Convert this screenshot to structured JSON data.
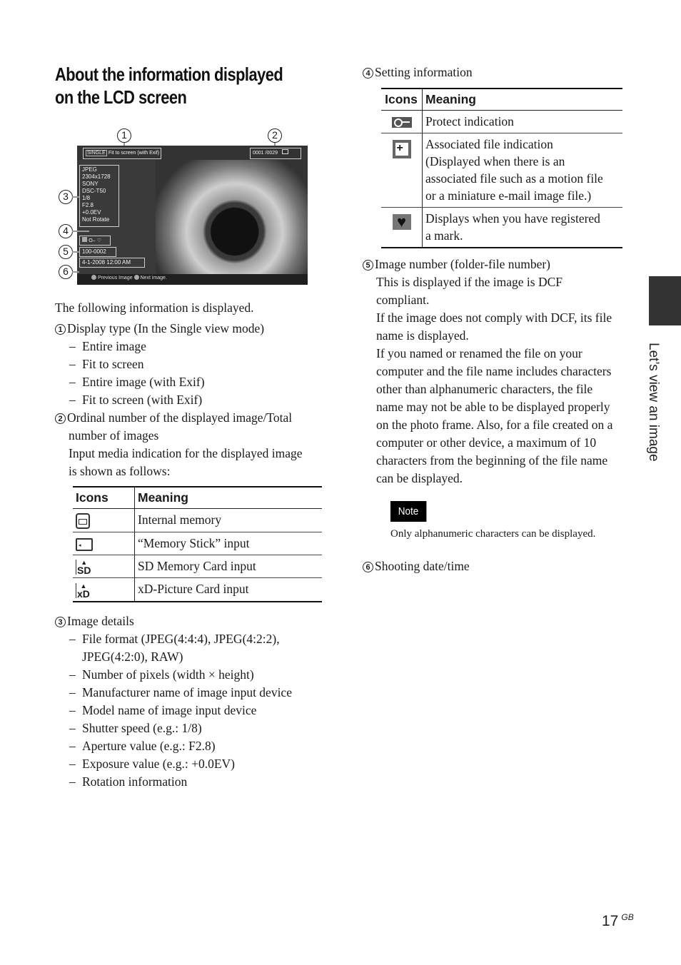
{
  "page": {
    "title_line1": "About the information displayed",
    "title_line2": "on the LCD screen",
    "side_tab_label": "Let’s view an image",
    "page_number": "17",
    "page_suffix": "GB"
  },
  "lcd_figure": {
    "callouts": [
      "1",
      "2",
      "3",
      "4",
      "5",
      "6"
    ],
    "display_mode_badge": "SINGLE",
    "display_mode_text": "Fit to screen (with Exif)",
    "image_counter": "0001 /0029",
    "exif": [
      "JPEG",
      "2304x1728",
      "SONY",
      "DSC-T50",
      "1/8",
      "F2.8",
      "+0.0EV",
      "Not Rotate"
    ],
    "setting_icons": [
      "associated-file-icon",
      "protect-key-icon",
      "heart-mark-icon"
    ],
    "image_number": "100-0002",
    "date_time": "4-1-2008 12:00 AM",
    "nav_prev": "Previous Image",
    "nav_next": "Next image."
  },
  "left_column": {
    "intro": "The following information is displayed.",
    "item1": {
      "num": "1",
      "heading": "Display type (In the Single view mode)",
      "bullets": [
        "Entire image",
        "Fit to screen",
        "Entire image (with Exif)",
        "Fit to screen (with Exif)"
      ]
    },
    "item2": {
      "num": "2",
      "heading_line1": "Ordinal number of the displayed image/Total",
      "heading_line2": "number of images",
      "desc_line1": "Input media indication for the displayed image",
      "desc_line2": "is shown as follows:"
    },
    "media_table": {
      "headers": [
        "Icons",
        "Meaning"
      ],
      "rows": [
        {
          "icon": "internal-memory-icon",
          "meaning": "Internal memory"
        },
        {
          "icon": "memory-stick-icon",
          "meaning": "“Memory Stick” input"
        },
        {
          "icon": "sd-card-icon",
          "meaning": "SD Memory Card input",
          "icon_text": "SD"
        },
        {
          "icon": "xd-card-icon",
          "meaning": "xD-Picture Card input",
          "icon_text": "xD"
        }
      ]
    },
    "item3": {
      "num": "3",
      "heading": "Image details",
      "bullets": [
        "File format (JPEG(4:4:4), JPEG(4:2:2),",
        "Number of pixels (width × height)",
        "Manufacturer name of image input device",
        "Model name of image input device",
        "Shutter speed (e.g.: 1/8)",
        "Aperture value (e.g.: F2.8)",
        "Exposure value (e.g.: +0.0EV)",
        "Rotation information"
      ],
      "bullet1_cont": "JPEG(4:2:0), RAW)"
    }
  },
  "right_column": {
    "item4": {
      "num": "4",
      "heading": "Setting information"
    },
    "settings_table": {
      "headers": [
        "Icons",
        "Meaning"
      ],
      "rows": [
        {
          "icon": "protect-key-icon",
          "lines": [
            "Protect indication"
          ]
        },
        {
          "icon": "associated-file-icon",
          "lines": [
            "Associated file indication",
            "(Displayed when there is an",
            "associated file such as a motion file",
            "or a miniature e-mail image file.)"
          ]
        },
        {
          "icon": "heart-mark-icon",
          "lines": [
            "Displays when you have registered",
            "a mark."
          ]
        }
      ]
    },
    "item5": {
      "num": "5",
      "heading": "Image number (folder-file number)",
      "lines": [
        "This is displayed if the image is DCF",
        "compliant.",
        "If the image does not comply with DCF, its file",
        "name is displayed.",
        "If you named or renamed the file on your",
        "computer and the file name includes characters",
        "other than alphanumeric characters, the file",
        "name may not be able to be displayed properly",
        "on the photo frame. Also, for a file created on a",
        "computer or other device, a maximum of 10",
        "characters from the beginning of the file name",
        "can be displayed."
      ]
    },
    "note": {
      "label": "Note",
      "text": "Only alphanumeric characters can be displayed."
    },
    "item6": {
      "num": "6",
      "heading": "Shooting date/time"
    }
  }
}
